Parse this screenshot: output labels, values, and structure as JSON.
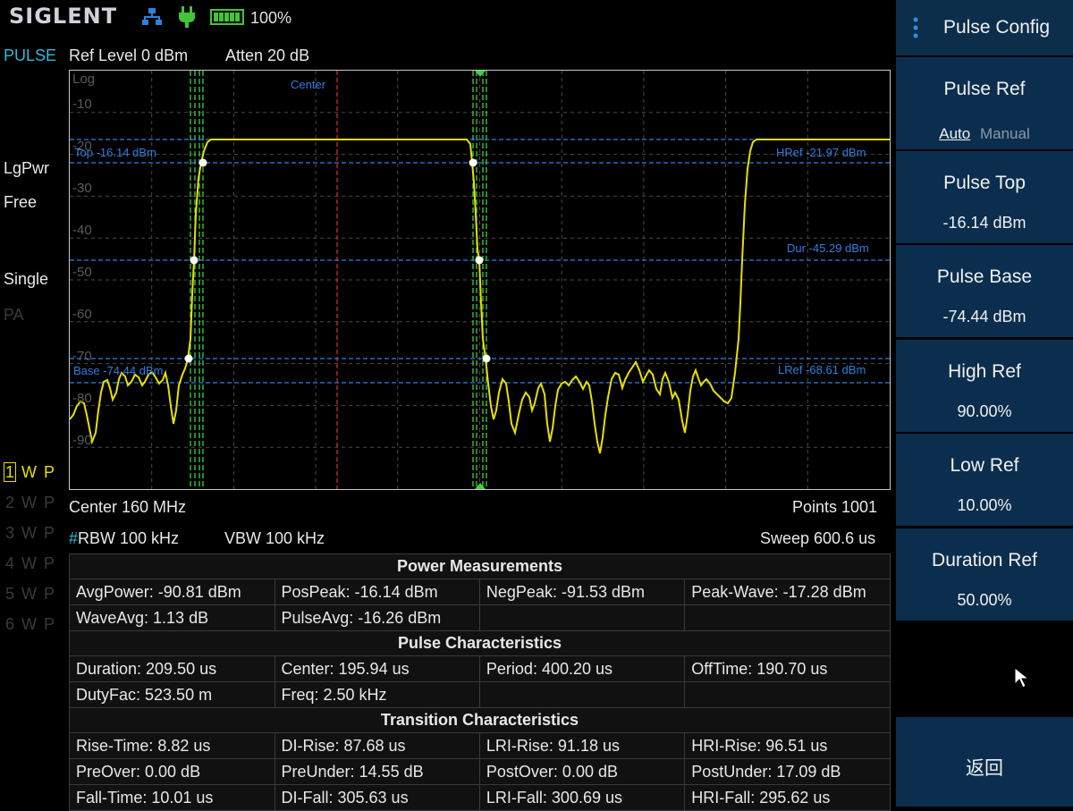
{
  "status": {
    "brand": "SIGLENT",
    "battery_pct": "100%",
    "icons": [
      "network-icon",
      "power-plug-icon",
      "battery-icon"
    ]
  },
  "header": {
    "mode": "PULSE",
    "ref_level": "Ref Level  0 dBm",
    "atten": "Atten  20 dB"
  },
  "side": {
    "detector": "LgPwr",
    "trigger": "Free",
    "sweep_mode": "Single",
    "pa": "PA",
    "traces": [
      {
        "num": "1",
        "w": "W",
        "p": "P",
        "active": true
      },
      {
        "num": "2",
        "w": "W",
        "p": "P",
        "active": false
      },
      {
        "num": "3",
        "w": "W",
        "p": "P",
        "active": false
      },
      {
        "num": "4",
        "w": "W",
        "p": "P",
        "active": false
      },
      {
        "num": "5",
        "w": "W",
        "p": "P",
        "active": false
      },
      {
        "num": "6",
        "w": "W",
        "p": "P",
        "active": false
      }
    ]
  },
  "graph": {
    "scale": "Log",
    "y_ticks": [
      "-10",
      "-20",
      "-30",
      "-40",
      "-50",
      "-60",
      "-70",
      "-80",
      "-90"
    ],
    "center_marker": "Center",
    "top_label": "Top -16.14 dBm",
    "base_label": "Base -74.44 dBm",
    "href_label": "HRef -21.97 dBm",
    "dur_label": "Dur -45.29 dBm",
    "lref_label": "LRef -68.61 dBm"
  },
  "footer": {
    "center": "Center  160 MHz",
    "points": "Points  1001",
    "rbw_hash": "#",
    "rbw": "RBW  100 kHz",
    "vbw": "VBW  100 kHz",
    "sweep": "Sweep  600.6 us"
  },
  "measurements": {
    "power_title": "Power Measurements",
    "power_rows": [
      [
        "AvgPower: -90.81 dBm",
        "PosPeak: -16.14 dBm",
        "NegPeak: -91.53 dBm",
        "Peak-Wave: -17.28 dBm"
      ],
      [
        "WaveAvg: 1.13 dB",
        "PulseAvg: -16.26 dBm",
        "",
        ""
      ]
    ],
    "pulse_title": "Pulse Characteristics",
    "pulse_rows": [
      [
        "Duration: 209.50 us",
        "Center: 195.94 us",
        "Period: 400.20 us",
        "OffTime: 190.70 us"
      ],
      [
        "DutyFac: 523.50 m",
        "Freq: 2.50 kHz",
        "",
        ""
      ]
    ],
    "trans_title": "Transition Characteristics",
    "trans_rows": [
      [
        "Rise-Time: 8.82 us",
        "DI-Rise: 87.68 us",
        "LRI-Rise: 91.18 us",
        "HRI-Rise: 96.51 us"
      ],
      [
        "PreOver: 0.00 dB",
        "PreUnder: 14.55 dB",
        "PostOver: 0.00 dB",
        "PostUnder: 17.09 dB"
      ],
      [
        "Fall-Time: 10.01 us",
        "DI-Fall: 305.63 us",
        "LRI-Fall: 300.69 us",
        "HRI-Fall: 295.62 us"
      ]
    ]
  },
  "menu": {
    "title": "Pulse Config",
    "pulse_ref": {
      "label": "Pulse Ref",
      "auto": "Auto",
      "manual": "Manual"
    },
    "pulse_top": {
      "label": "Pulse Top",
      "value": "-16.14 dBm"
    },
    "pulse_base": {
      "label": "Pulse Base",
      "value": "-74.44 dBm"
    },
    "high_ref": {
      "label": "High Ref",
      "value": "90.00%"
    },
    "low_ref": {
      "label": "Low Ref",
      "value": "10.00%"
    },
    "duration_ref": {
      "label": "Duration Ref",
      "value": "50.00%"
    },
    "back": "返回"
  },
  "colors": {
    "trace": "#e8e000",
    "ref_lines": "#2f7fe0",
    "edge_markers": "#3fcf3f",
    "center_line": "#e03030",
    "menu_bg": "#0b2e4e",
    "mode_text": "#2fb8d8"
  }
}
